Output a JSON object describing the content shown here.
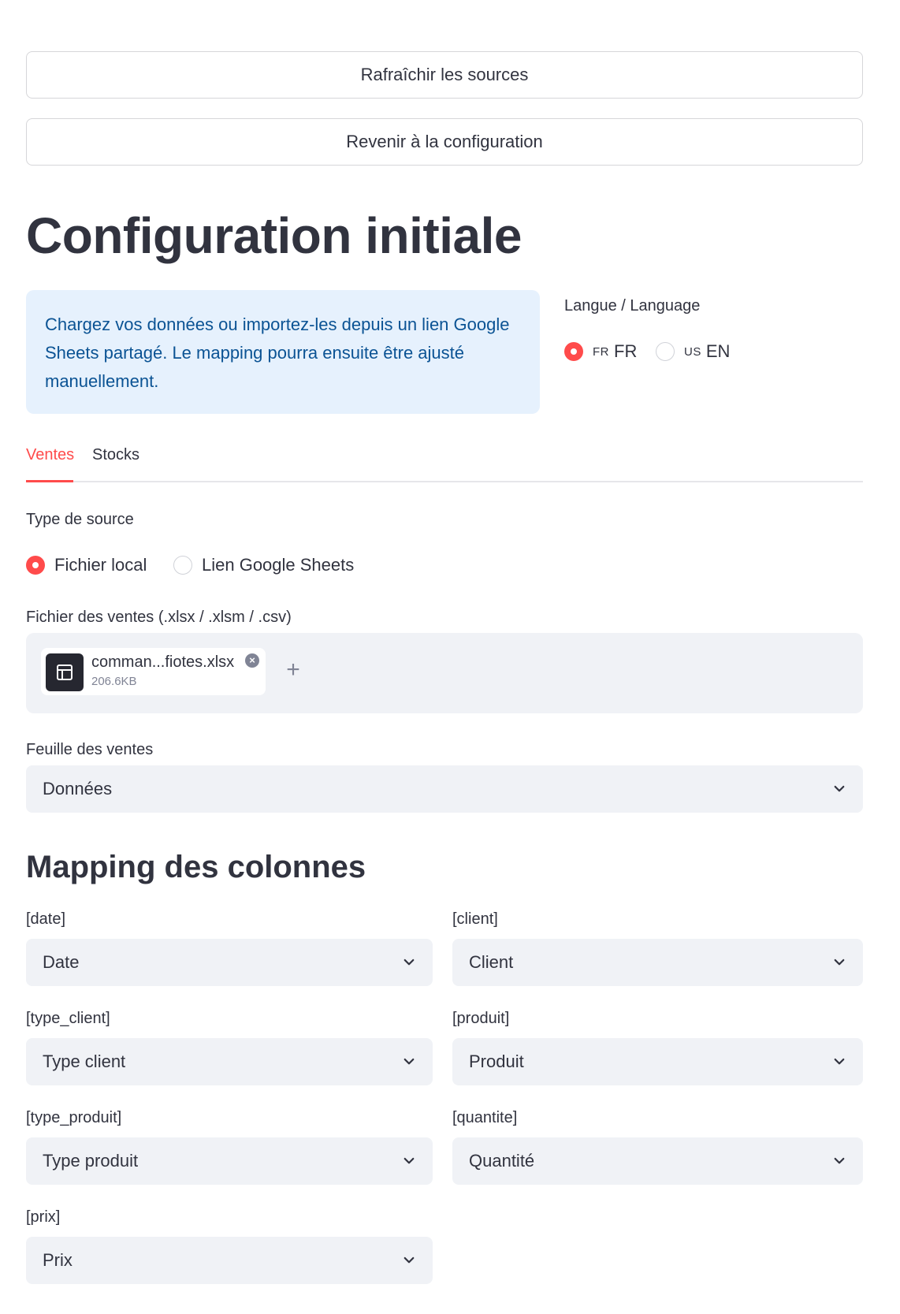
{
  "toolbar": {
    "refresh_label": "Rafraîchir les sources",
    "back_label": "Revenir à la configuration"
  },
  "page_title": "Configuration initiale",
  "info_text": "Chargez vos données ou importez-les depuis un lien Google Sheets partagé. Le mapping pourra ensuite être ajusté manuellement.",
  "language": {
    "label": "Langue / Language",
    "options": [
      {
        "flag": "FR",
        "label": "FR",
        "selected": true
      },
      {
        "flag": "US",
        "label": "EN",
        "selected": false
      }
    ]
  },
  "tabs": [
    {
      "label": "Ventes",
      "active": true
    },
    {
      "label": "Stocks",
      "active": false
    }
  ],
  "source_type": {
    "label": "Type de source",
    "options": [
      {
        "label": "Fichier local",
        "selected": true
      },
      {
        "label": "Lien Google Sheets",
        "selected": false
      }
    ]
  },
  "uploader": {
    "label": "Fichier des ventes (.xlsx / .xlsm / .csv)",
    "file_name": "comman...fiotes.xlsx",
    "file_size": "206.6KB",
    "add_symbol": "+"
  },
  "sheet": {
    "label": "Feuille des ventes",
    "value": "Données"
  },
  "mapping": {
    "title": "Mapping des colonnes",
    "fields": [
      {
        "label": "[date]",
        "value": "Date"
      },
      {
        "label": "[client]",
        "value": "Client"
      },
      {
        "label": "[type_client]",
        "value": "Type client"
      },
      {
        "label": "[produit]",
        "value": "Produit"
      },
      {
        "label": "[type_produit]",
        "value": "Type produit"
      },
      {
        "label": "[quantite]",
        "value": "Quantité"
      },
      {
        "label": "[prix]",
        "value": "Prix"
      }
    ]
  },
  "colors": {
    "accent": "#ff4b4b",
    "info_bg": "#e6f1fd",
    "info_text": "#0b5394",
    "input_bg": "#f0f2f6"
  },
  "icons": {
    "file": "table-file-icon",
    "remove": "close-circle-icon",
    "select": "chevron-down-icon"
  }
}
